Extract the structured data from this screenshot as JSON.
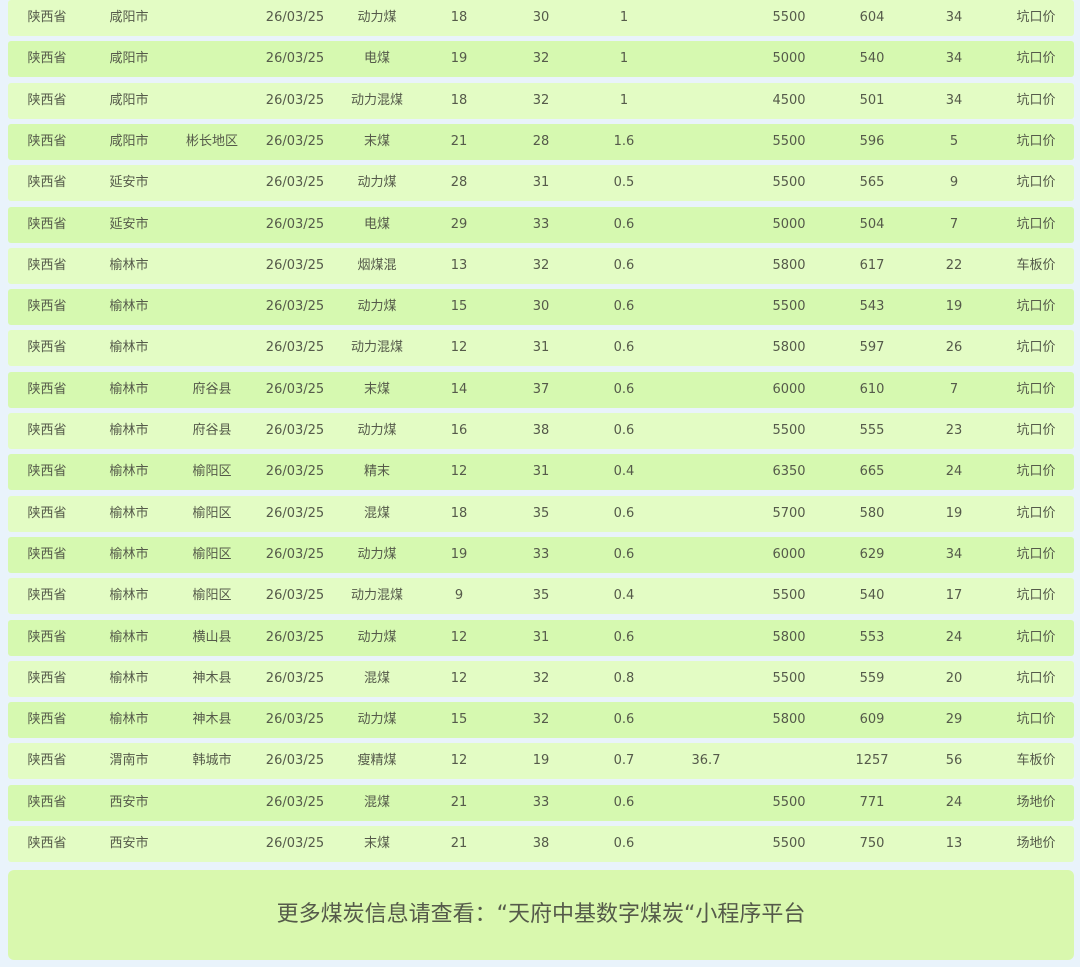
{
  "table": {
    "rows": [
      [
        "陕西省",
        "咸阳市",
        "",
        "26/03/25",
        "动力煤",
        "18",
        "30",
        "1",
        "",
        "5500",
        "604",
        "34",
        "坑口价"
      ],
      [
        "陕西省",
        "咸阳市",
        "",
        "26/03/25",
        "电煤",
        "19",
        "32",
        "1",
        "",
        "5000",
        "540",
        "34",
        "坑口价"
      ],
      [
        "陕西省",
        "咸阳市",
        "",
        "26/03/25",
        "动力混煤",
        "18",
        "32",
        "1",
        "",
        "4500",
        "501",
        "34",
        "坑口价"
      ],
      [
        "陕西省",
        "咸阳市",
        "彬长地区",
        "26/03/25",
        "末煤",
        "21",
        "28",
        "1.6",
        "",
        "5500",
        "596",
        "5",
        "坑口价"
      ],
      [
        "陕西省",
        "延安市",
        "",
        "26/03/25",
        "动力煤",
        "28",
        "31",
        "0.5",
        "",
        "5500",
        "565",
        "9",
        "坑口价"
      ],
      [
        "陕西省",
        "延安市",
        "",
        "26/03/25",
        "电煤",
        "29",
        "33",
        "0.6",
        "",
        "5000",
        "504",
        "7",
        "坑口价"
      ],
      [
        "陕西省",
        "榆林市",
        "",
        "26/03/25",
        "烟煤混",
        "13",
        "32",
        "0.6",
        "",
        "5800",
        "617",
        "22",
        "车板价"
      ],
      [
        "陕西省",
        "榆林市",
        "",
        "26/03/25",
        "动力煤",
        "15",
        "30",
        "0.6",
        "",
        "5500",
        "543",
        "19",
        "坑口价"
      ],
      [
        "陕西省",
        "榆林市",
        "",
        "26/03/25",
        "动力混煤",
        "12",
        "31",
        "0.6",
        "",
        "5800",
        "597",
        "26",
        "坑口价"
      ],
      [
        "陕西省",
        "榆林市",
        "府谷县",
        "26/03/25",
        "末煤",
        "14",
        "37",
        "0.6",
        "",
        "6000",
        "610",
        "7",
        "坑口价"
      ],
      [
        "陕西省",
        "榆林市",
        "府谷县",
        "26/03/25",
        "动力煤",
        "16",
        "38",
        "0.6",
        "",
        "5500",
        "555",
        "23",
        "坑口价"
      ],
      [
        "陕西省",
        "榆林市",
        "榆阳区",
        "26/03/25",
        "精末",
        "12",
        "31",
        "0.4",
        "",
        "6350",
        "665",
        "24",
        "坑口价"
      ],
      [
        "陕西省",
        "榆林市",
        "榆阳区",
        "26/03/25",
        "混煤",
        "18",
        "35",
        "0.6",
        "",
        "5700",
        "580",
        "19",
        "坑口价"
      ],
      [
        "陕西省",
        "榆林市",
        "榆阳区",
        "26/03/25",
        "动力煤",
        "19",
        "33",
        "0.6",
        "",
        "6000",
        "629",
        "34",
        "坑口价"
      ],
      [
        "陕西省",
        "榆林市",
        "榆阳区",
        "26/03/25",
        "动力混煤",
        "9",
        "35",
        "0.4",
        "",
        "5500",
        "540",
        "17",
        "坑口价"
      ],
      [
        "陕西省",
        "榆林市",
        "横山县",
        "26/03/25",
        "动力煤",
        "12",
        "31",
        "0.6",
        "",
        "5800",
        "553",
        "24",
        "坑口价"
      ],
      [
        "陕西省",
        "榆林市",
        "神木县",
        "26/03/25",
        "混煤",
        "12",
        "32",
        "0.8",
        "",
        "5500",
        "559",
        "20",
        "坑口价"
      ],
      [
        "陕西省",
        "榆林市",
        "神木县",
        "26/03/25",
        "动力煤",
        "15",
        "32",
        "0.6",
        "",
        "5800",
        "609",
        "29",
        "坑口价"
      ],
      [
        "陕西省",
        "渭南市",
        "韩城市",
        "26/03/25",
        "瘦精煤",
        "12",
        "19",
        "0.7",
        "36.7",
        "",
        "1257",
        "56",
        "车板价"
      ],
      [
        "陕西省",
        "西安市",
        "",
        "26/03/25",
        "混煤",
        "21",
        "33",
        "0.6",
        "",
        "5500",
        "771",
        "24",
        "场地价"
      ],
      [
        "陕西省",
        "西安市",
        "",
        "26/03/25",
        "末煤",
        "21",
        "38",
        "0.6",
        "",
        "5500",
        "750",
        "13",
        "场地价"
      ]
    ]
  },
  "footer": {
    "text": "更多煤炭信息请查看：“天府中基数字煤炭“小程序平台"
  }
}
